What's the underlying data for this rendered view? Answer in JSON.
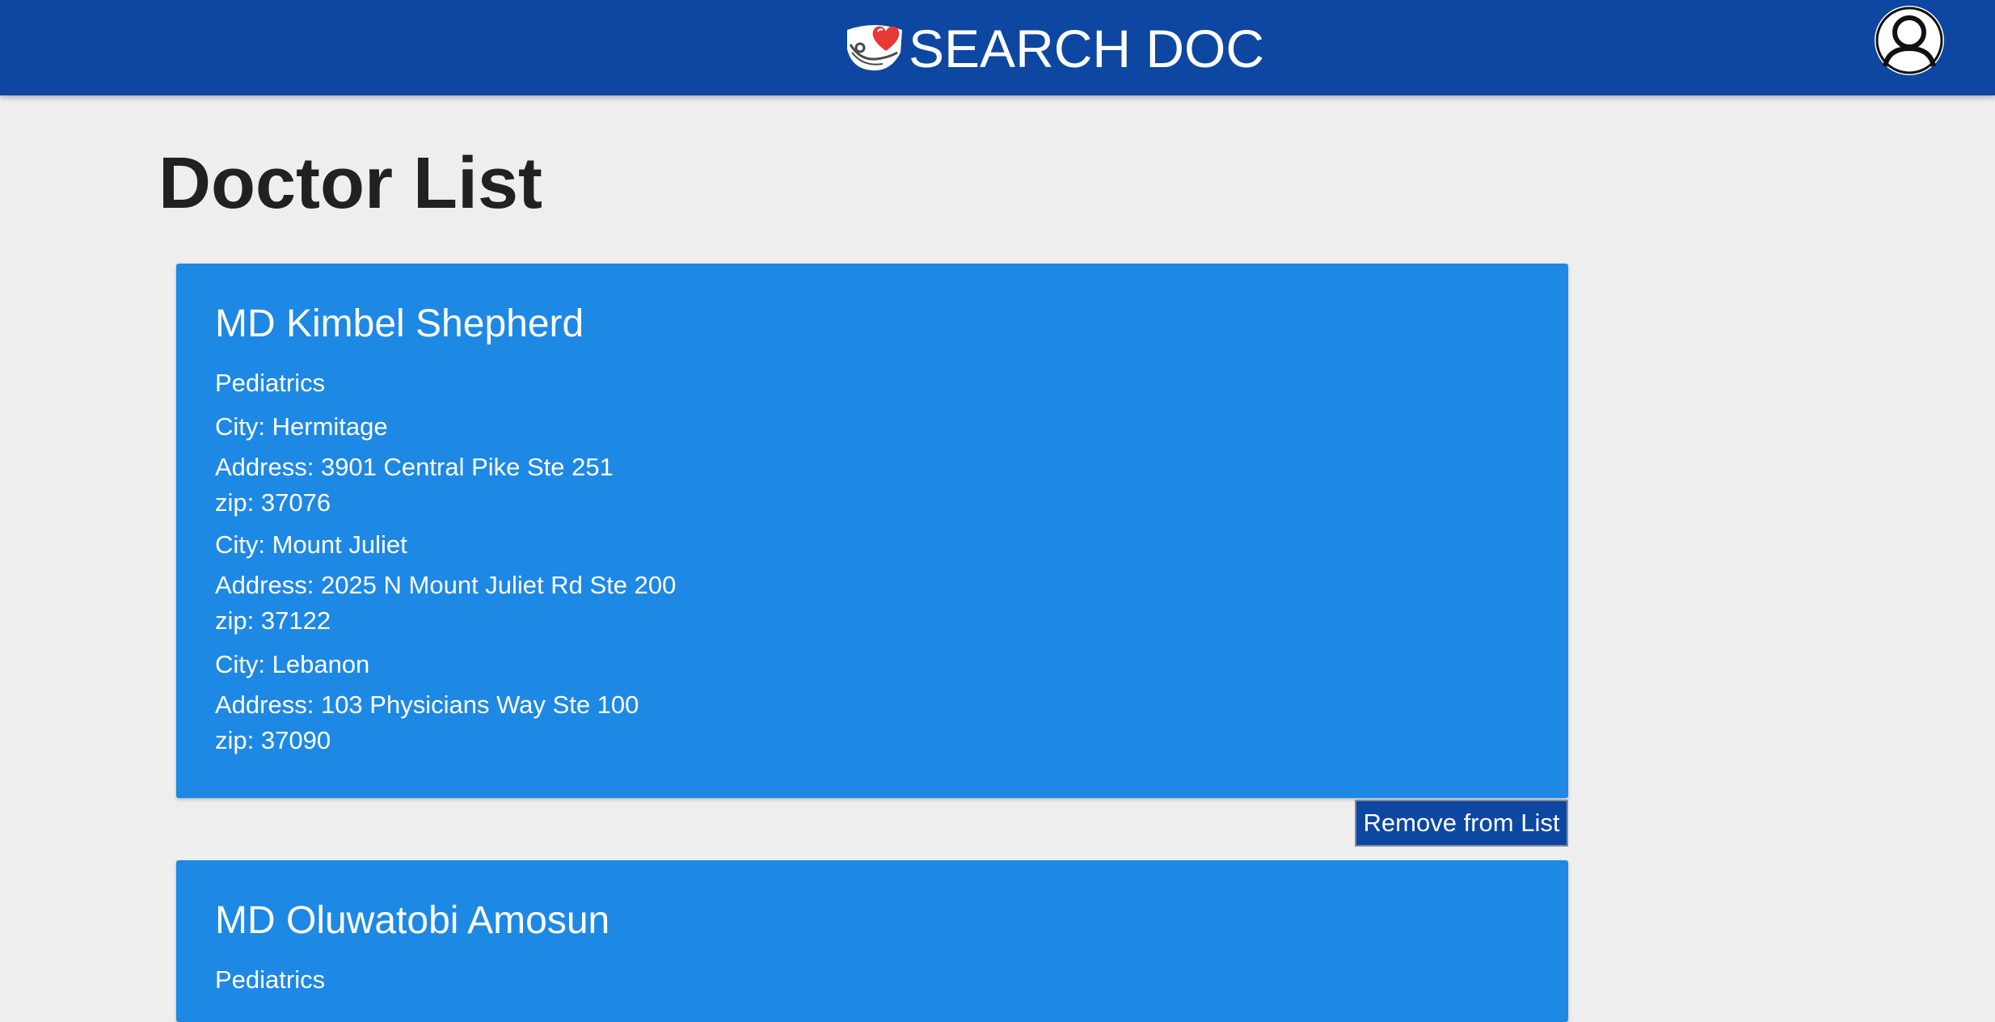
{
  "header": {
    "app_title": "SEARCH DOC",
    "logo_icon": "heart-stethoscope-logo-icon",
    "profile_icon": "user-profile-icon",
    "background_color": "#0d47a1"
  },
  "page": {
    "title": "Doctor List"
  },
  "doctors": [
    {
      "name": "MD Kimbel Shepherd",
      "specialty": "Pediatrics",
      "locations": [
        {
          "city": "City: Hermitage",
          "address": "Address: 3901 Central Pike Ste 251",
          "zip": "zip: 37076"
        },
        {
          "city": "City: Mount Juliet",
          "address": "Address: 2025 N Mount Juliet Rd Ste 200",
          "zip": "zip: 37122"
        },
        {
          "city": "City: Lebanon",
          "address": "Address: 103 Physicians Way Ste 100",
          "zip": "zip: 37090"
        }
      ],
      "remove_label": "Remove from List"
    },
    {
      "name": "MD Oluwatobi Amosun",
      "specialty": "Pediatrics"
    }
  ],
  "colors": {
    "card": "#1e88e5",
    "button": "#0d47a1",
    "page_background": "#eeeeee"
  }
}
